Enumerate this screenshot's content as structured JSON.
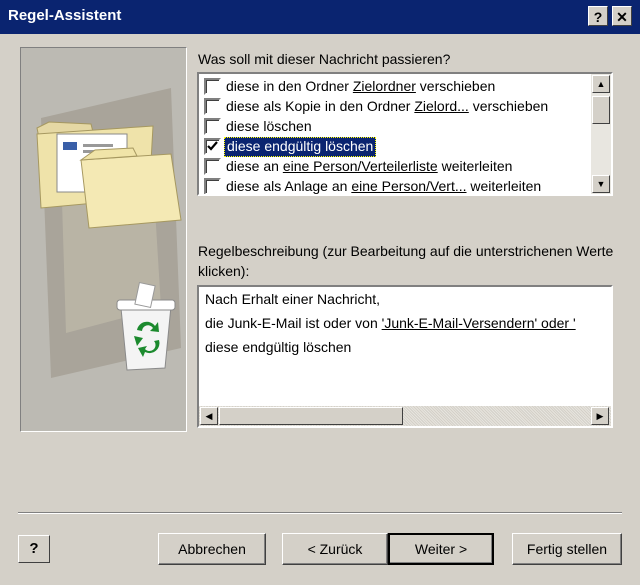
{
  "window": {
    "title": "Regel-Assistent",
    "help_glyph": "?",
    "close_glyph": "✕"
  },
  "actions": {
    "prompt": "Was soll mit dieser Nachricht passieren?",
    "items": [
      {
        "checked": false,
        "selected": false,
        "before": "diese in den Ordner ",
        "link": "Zielordner",
        "after": " verschieben"
      },
      {
        "checked": false,
        "selected": false,
        "before": "diese als Kopie in den Ordner ",
        "link": "Zielord...",
        "after": "  verschieben"
      },
      {
        "checked": false,
        "selected": false,
        "before": "diese löschen",
        "link": "",
        "after": ""
      },
      {
        "checked": true,
        "selected": true,
        "before": "diese endgültig löschen",
        "link": "",
        "after": ""
      },
      {
        "checked": false,
        "selected": false,
        "before": "diese an ",
        "link": "eine Person/Verteilerliste",
        "after": " weiterleiten"
      },
      {
        "checked": false,
        "selected": false,
        "before": "diese als Anlage an ",
        "link": "eine Person/Vert...",
        "after": "  weiterleiten"
      }
    ]
  },
  "description": {
    "label": "Regelbeschreibung (zur Bearbeitung auf die unterstrichenen Werte klicken):",
    "line1": "Nach Erhalt einer Nachricht,",
    "line2_prefix": "die Junk-E-Mail ist oder von ",
    "line2_link": "'Junk-E-Mail-Versendern' oder '",
    "line3": "diese endgültig löschen"
  },
  "buttons": {
    "help": "?",
    "cancel": "Abbrechen",
    "back": "< Zurück",
    "next": "Weiter >",
    "finish": "Fertig stellen"
  },
  "colors": {
    "titlebar": "#0a2470",
    "dialog": "#d4d0c8",
    "selection": "#0a2470",
    "recycle_green": "#1c8a2e"
  }
}
